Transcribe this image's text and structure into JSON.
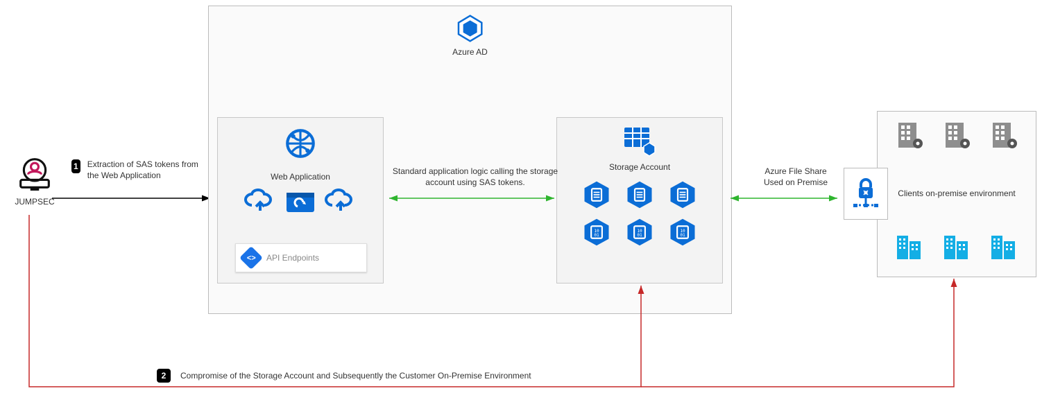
{
  "actor": {
    "label": "JUMPSEC"
  },
  "azure": {
    "ad_label": "Azure AD"
  },
  "webapp": {
    "title": "Web Application",
    "api_label": "API Endpoints"
  },
  "storage": {
    "title": "Storage Account"
  },
  "onprem": {
    "title": "Clients on-premise environment"
  },
  "mid_label": "Standard application logic calling the storage account using SAS tokens.",
  "fshare_label": "Azure File Share Used on Premise",
  "step1": {
    "num": "1",
    "text": "Extraction of SAS tokens from the Web Application"
  },
  "step2": {
    "num": "2",
    "text": "Compromise of the Storage Account and Subsequently the Customer On-Premise Environment"
  }
}
